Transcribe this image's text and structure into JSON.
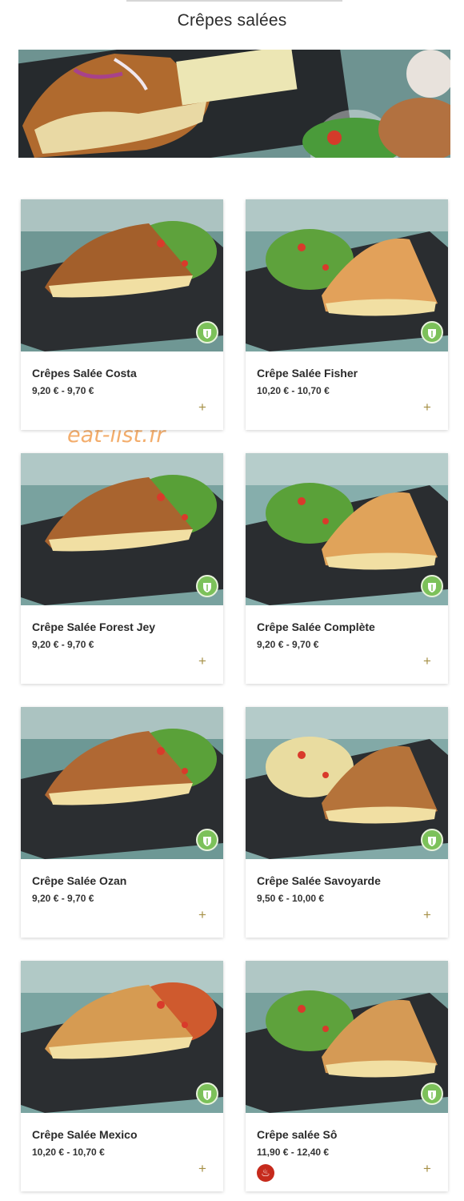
{
  "page": {
    "title": "Crêpes salées",
    "watermark": "eat-list.fr"
  },
  "colors": {
    "accent_plus": "#a69046",
    "veggie_badge": "#7cc15a",
    "spicy_badge": "#c62a1c"
  },
  "items": [
    {
      "name": "Crêpes Salée Costa",
      "price": "9,20 € - 9,70 €",
      "veggie": true
    },
    {
      "name": "Crêpe Salée Fisher",
      "price": "10,20 € - 10,70 €",
      "veggie": true
    },
    {
      "name": "Crêpe Salée Forest Jey",
      "price": "9,20 € - 9,70 €",
      "veggie": true
    },
    {
      "name": "Crêpe Salée Complète",
      "price": "9,20 € - 9,70 €",
      "veggie": true
    },
    {
      "name": "Crêpe Salée Ozan",
      "price": "9,20 € - 9,70 €",
      "veggie": true
    },
    {
      "name": "Crêpe Salée Savoyarde",
      "price": "9,50 € - 10,00 €",
      "veggie": true
    },
    {
      "name": "Crêpe Salée Mexico",
      "price": "10,20 € - 10,70 €",
      "veggie": true
    },
    {
      "name": "Crêpe salée Sô",
      "price": "11,90 € - 12,40 €",
      "veggie": true,
      "spicy": true
    }
  ],
  "icons": {
    "add": "plus-icon",
    "veggie": "leaf-badge-icon",
    "spicy": "chili-icon"
  },
  "add_symbol": "+",
  "spicy_symbol": "♨"
}
